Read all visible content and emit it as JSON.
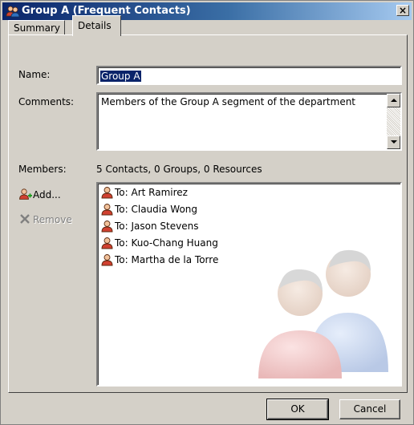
{
  "window": {
    "title": "Group A (Frequent Contacts)",
    "close_label": "×"
  },
  "tabs": [
    {
      "label": "Summary",
      "active": false
    },
    {
      "label": "Details",
      "active": true
    }
  ],
  "form": {
    "name_label": "Name:",
    "name_value": "Group A",
    "comments_label": "Comments:",
    "comments_value": "Members of the Group A segment of the department",
    "members_label": "Members:",
    "members_summary": "5 Contacts, 0 Groups, 0 Resources"
  },
  "actions": {
    "add_label": "Add...",
    "remove_label": "Remove",
    "remove_enabled": false
  },
  "members": [
    {
      "label": "To: Art Ramirez",
      "icon": "person-icon"
    },
    {
      "label": "To: Claudia Wong",
      "icon": "person-icon"
    },
    {
      "label": "To: Jason Stevens",
      "icon": "person-icon"
    },
    {
      "label": "To: Kuo-Chang Huang",
      "icon": "person-icon"
    },
    {
      "label": "To: Martha de la Torre",
      "icon": "person-icon"
    }
  ],
  "footer": {
    "ok_label": "OK",
    "cancel_label": "Cancel"
  },
  "colors": {
    "titlebar_start": "#0a246a",
    "titlebar_end": "#a6caf0",
    "dialog_face": "#d4d0c8",
    "selection": "#0a246a"
  }
}
